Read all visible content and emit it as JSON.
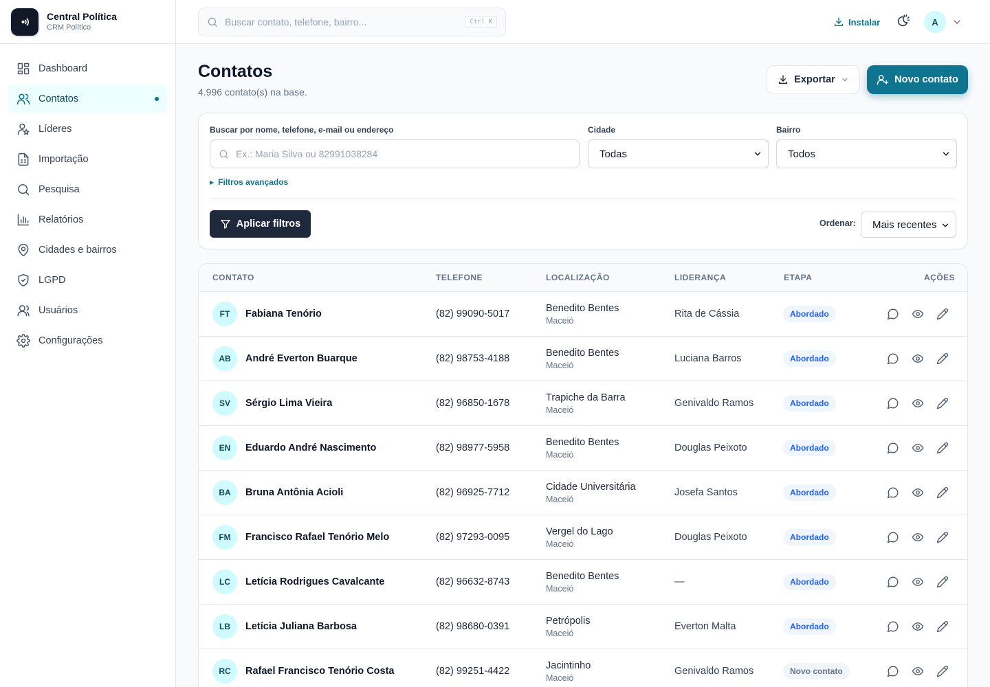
{
  "brand": {
    "title": "Central Política",
    "subtitle": "CRM Político"
  },
  "sidebar": {
    "items": [
      {
        "label": "Dashboard",
        "icon": "dashboard-icon",
        "active": false
      },
      {
        "label": "Contatos",
        "icon": "users-icon",
        "active": true
      },
      {
        "label": "Líderes",
        "icon": "user-star-icon",
        "active": false
      },
      {
        "label": "Importação",
        "icon": "file-sheet-icon",
        "active": false
      },
      {
        "label": "Pesquisa",
        "icon": "search-icon",
        "active": false
      },
      {
        "label": "Relatórios",
        "icon": "bar-chart-icon",
        "active": false
      },
      {
        "label": "Cidades e bairros",
        "icon": "map-pin-icon",
        "active": false
      },
      {
        "label": "LGPD",
        "icon": "shield-icon",
        "active": false
      },
      {
        "label": "Usuários",
        "icon": "user-icon",
        "active": false
      },
      {
        "label": "Configurações",
        "icon": "gear-icon",
        "active": false
      }
    ]
  },
  "topbar": {
    "search_placeholder": "Buscar contato, telefone, bairro...",
    "shortcut": "Ctrl K",
    "install_label": "Instalar",
    "avatar_initial": "A"
  },
  "page": {
    "title": "Contatos",
    "subtitle": "4.996 contato(s) na base.",
    "export_label": "Exportar",
    "new_contact_label": "Novo contato"
  },
  "filters": {
    "search_label": "Buscar por nome, telefone, e-mail ou endereço",
    "search_placeholder": "Ex.: Maria Silva ou 82991038284",
    "city_label": "Cidade",
    "city_value": "Todas",
    "bairro_label": "Bairro",
    "bairro_value": "Todos",
    "advanced_label": "Filtros avançados",
    "apply_label": "Aplicar filtros",
    "order_label": "Ordenar:",
    "order_value": "Mais recentes"
  },
  "table": {
    "headers": {
      "contact": "CONTATO",
      "phone": "TELEFONE",
      "location": "LOCALIZAÇÃO",
      "leadership": "LIDERANÇA",
      "stage": "ETAPA",
      "actions": "AÇÕES"
    },
    "rows": [
      {
        "initials": "FT",
        "name": "Fabiana Tenório",
        "phone": "(82) 99090-5017",
        "bairro": "Benedito Bentes",
        "cidade": "Maceió",
        "lider": "Rita de Cássia",
        "stage": "Abordado"
      },
      {
        "initials": "AB",
        "name": "André Everton Buarque",
        "phone": "(82) 98753-4188",
        "bairro": "Benedito Bentes",
        "cidade": "Maceió",
        "lider": "Luciana Barros",
        "stage": "Abordado"
      },
      {
        "initials": "SV",
        "name": "Sérgio Lima Vieira",
        "phone": "(82) 96850-1678",
        "bairro": "Trapiche da Barra",
        "cidade": "Maceió",
        "lider": "Genivaldo Ramos",
        "stage": "Abordado"
      },
      {
        "initials": "EN",
        "name": "Eduardo André Nascimento",
        "phone": "(82) 98977-5958",
        "bairro": "Benedito Bentes",
        "cidade": "Maceió",
        "lider": "Douglas Peixoto",
        "stage": "Abordado"
      },
      {
        "initials": "BA",
        "name": "Bruna Antônia Acioli",
        "phone": "(82) 96925-7712",
        "bairro": "Cidade Universitária",
        "cidade": "Maceió",
        "lider": "Josefa Santos",
        "stage": "Abordado"
      },
      {
        "initials": "FM",
        "name": "Francisco Rafael Tenório Melo",
        "phone": "(82) 97293-0095",
        "bairro": "Vergel do Lago",
        "cidade": "Maceió",
        "lider": "Douglas Peixoto",
        "stage": "Abordado"
      },
      {
        "initials": "LC",
        "name": "Letícia Rodrigues Cavalcante",
        "phone": "(82) 96632-8743",
        "bairro": "Benedito Bentes",
        "cidade": "Maceió",
        "lider": "—",
        "stage": "Abordado"
      },
      {
        "initials": "LB",
        "name": "Letícia Juliana Barbosa",
        "phone": "(82) 98680-0391",
        "bairro": "Petrópolis",
        "cidade": "Maceió",
        "lider": "Everton Malta",
        "stage": "Abordado"
      },
      {
        "initials": "RC",
        "name": "Rafael Francisco Tenório Costa",
        "phone": "(82) 99251-4422",
        "bairro": "Jacintinho",
        "cidade": "Maceió",
        "lider": "Genivaldo Ramos",
        "stage": "Novo contato"
      }
    ]
  },
  "colors": {
    "accent": "#0e7490",
    "dark_button": "#1e293b",
    "badge_blue": "#2563eb",
    "avatar_bg": "#cffafe"
  }
}
